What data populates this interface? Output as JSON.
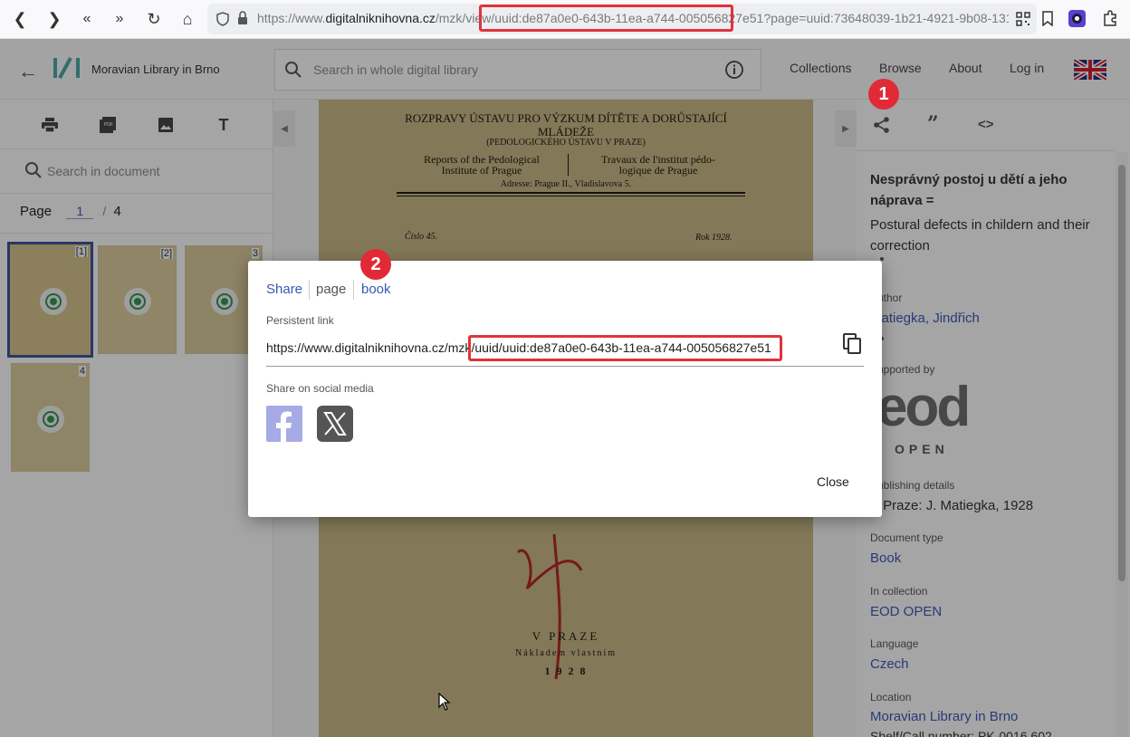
{
  "browser": {
    "url_prefix": "https://www.",
    "url_domain": "digitalniknihovna.cz",
    "url_rest": "/mzk/view/uuid:de87a0e0-643b-11ea-a744-005056827e51?page=uuid:73648039-1b21-4921-9b08-13161ae6d..."
  },
  "header": {
    "logo_text": "Moravian Library in Brno",
    "search_placeholder": "Search in whole digital library",
    "nav": [
      "Collections",
      "Browse",
      "About",
      "Log in"
    ]
  },
  "left_panel": {
    "tools": [
      "print-icon",
      "pdf-icon",
      "image-icon",
      "text-icon"
    ],
    "doc_search_placeholder": "Search in document",
    "page_label": "Page",
    "page_current": "1",
    "page_sep": "/",
    "page_total": "4",
    "thumbs": [
      "[1]",
      "[2]",
      "3",
      "4"
    ]
  },
  "page_scan": {
    "line1": "ROZPRAVY ÚSTAVU PRO VÝZKUM DÍTĚTE A DORŮSTAJÍCÍ",
    "line2": "MLÁDEŽE",
    "line3": "(PEDOLOGICKÉHO ÚSTAVU V PRAZE)",
    "col1a": "Reports of the Pedological",
    "col1b": "Institute of Prague",
    "col2a": "Travaux de l'institut pédo-",
    "col2b": "logique de Prague",
    "address": "Adresse: Prague II., Vladislavova 5.",
    "cislo": "Číslo 45.",
    "rok": "Rok 1928.",
    "bottom1": "V PRAZE",
    "bottom2": "Nákladem vlastním",
    "bottom3": "1 9 2 8"
  },
  "right_panel": {
    "title": "Nesprávný postoj u dětí a jeho náprava =",
    "subtitle": "Postural defects in childern and their correction",
    "author_label": "Author",
    "author": "Matiegka, Jindřich",
    "supported_label": "Supported by",
    "eod_logo": "eod",
    "eod_open": "OPEN",
    "publishing_label": "Publishing details",
    "publishing": "V Praze: J. Matiegka, 1928",
    "doctype_label": "Document type",
    "doctype": "Book",
    "collection_label": "In collection",
    "collection": "EOD OPEN",
    "language_label": "Language",
    "language": "Czech",
    "location_label": "Location",
    "location": "Moravian Library in Brno",
    "shelf": "Shelf/Call number: PK-0016.602"
  },
  "dialog": {
    "tab_share": "Share",
    "tab_page": "page",
    "tab_book": "book",
    "persistent_label": "Persistent link",
    "link_prefix": "https://www.digitalniknihovna.cz/mzk",
    "link_uuid": "/uuid/uuid:de87a0e0-643b-11ea-a744-005056827e51",
    "social_label": "Share on social media",
    "close": "Close"
  },
  "annotations": {
    "badge1": "1",
    "badge2": "2"
  },
  "colors": {
    "accent": "#3b56b3",
    "highlight": "#e0323a",
    "paper": "#c2b282"
  }
}
